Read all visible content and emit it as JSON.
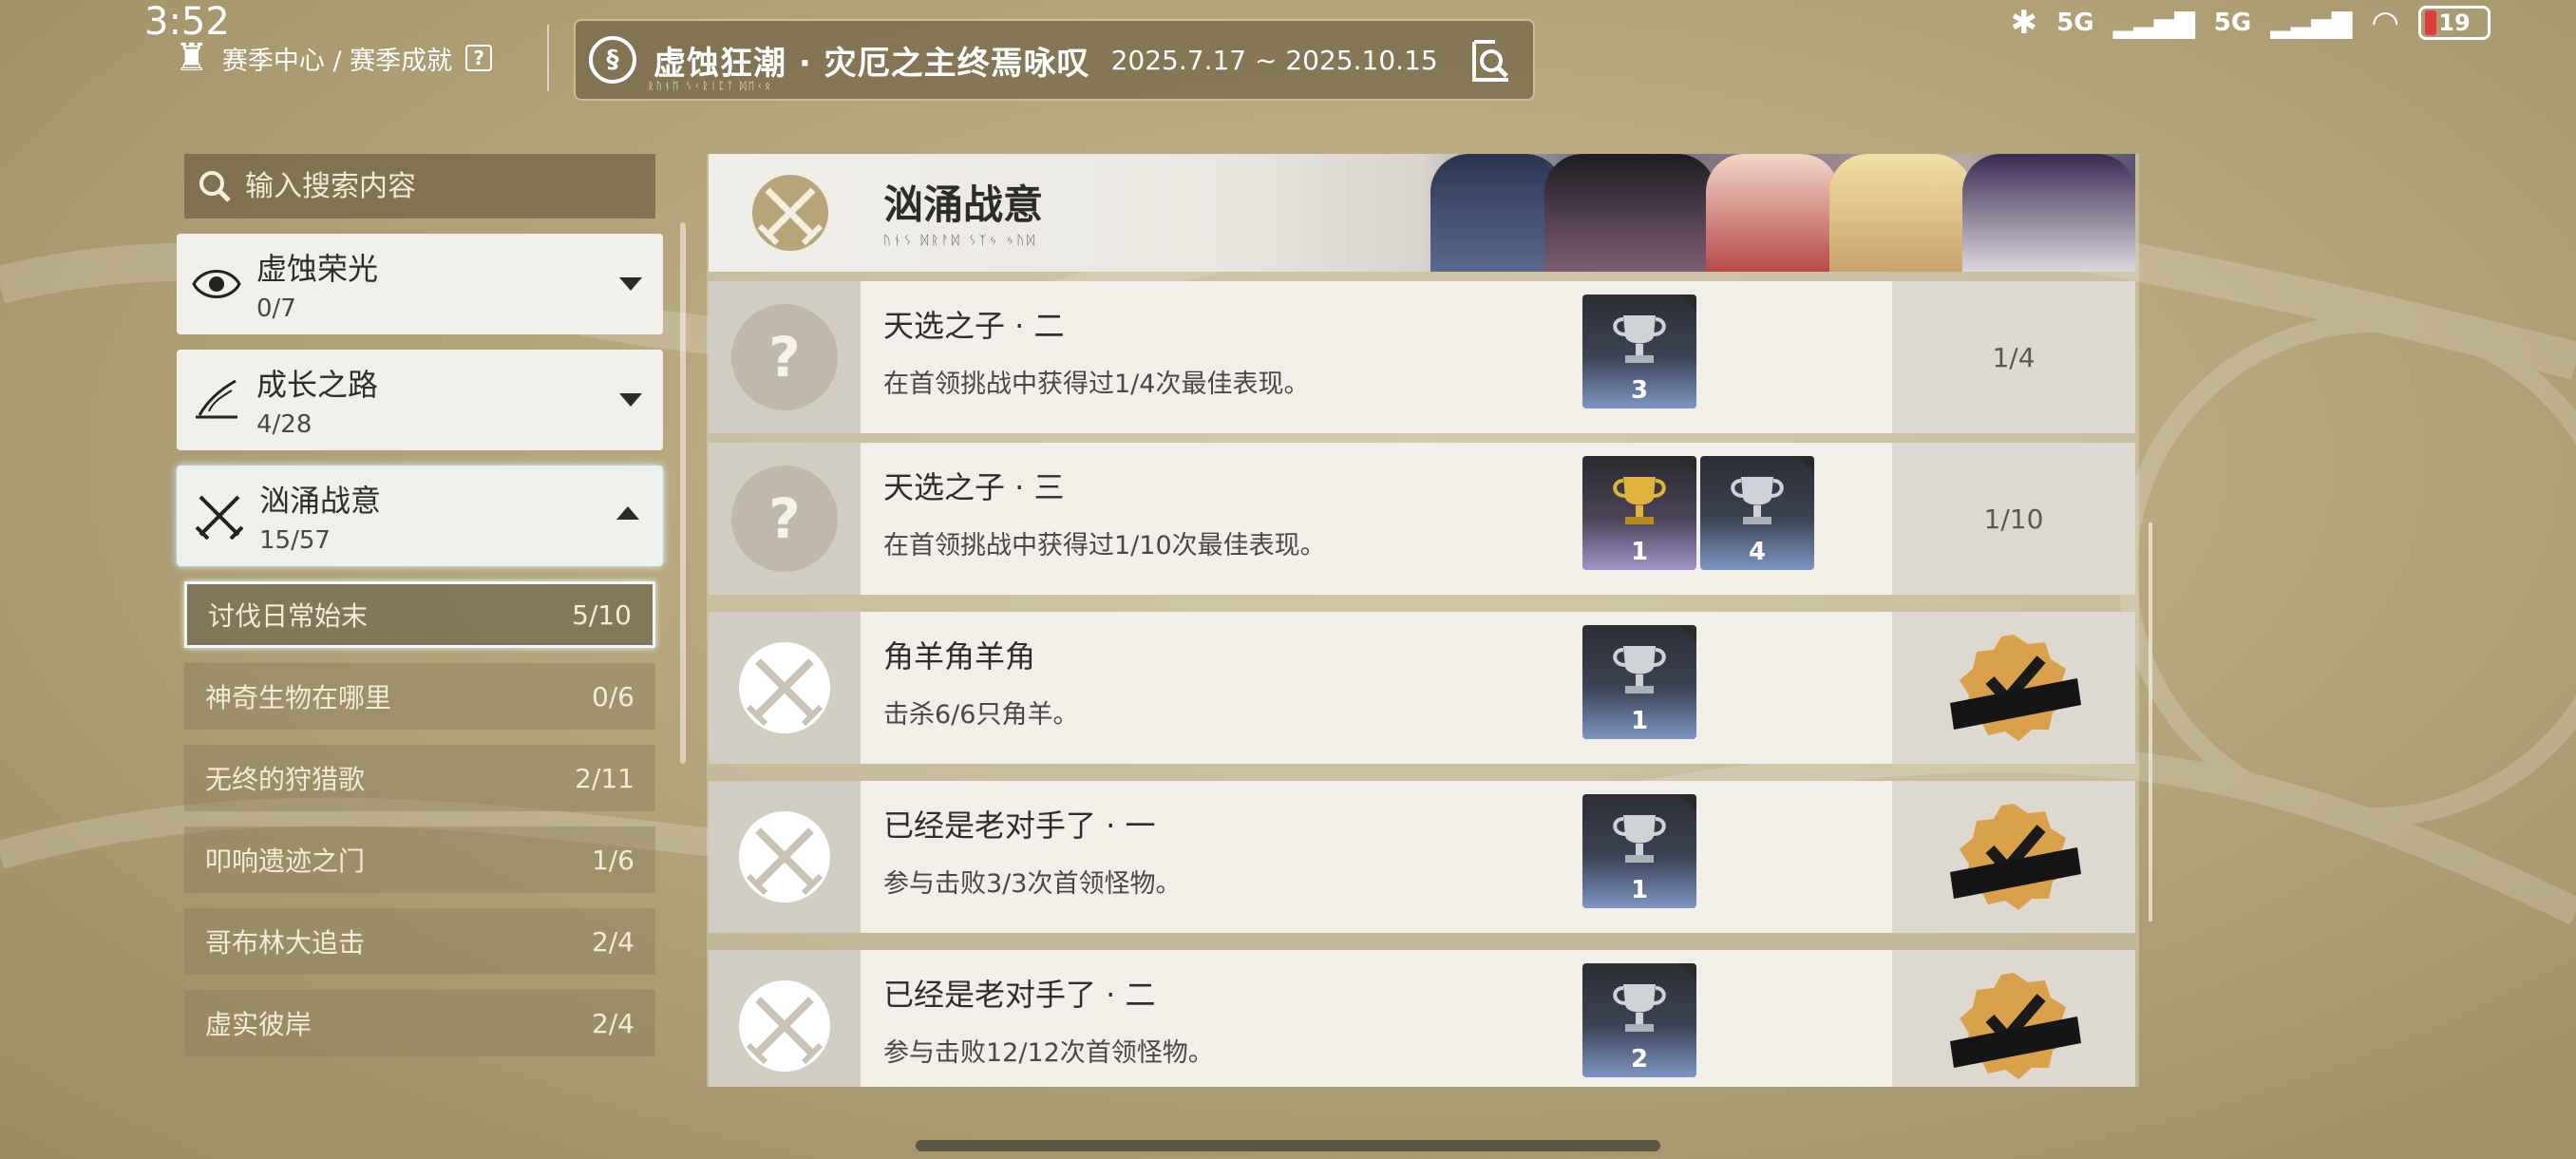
{
  "status": {
    "time": "3:52",
    "network1": "5G",
    "network2": "5G",
    "battery": "19"
  },
  "header": {
    "breadcrumb": "赛季中心 / 赛季成就",
    "help_label": "?",
    "season_title": "虚蚀狂潮 · 灾厄之主终焉咏叹",
    "season_dates": "2025.7.17 ~ 2025.10.15"
  },
  "search": {
    "placeholder": "输入搜索内容"
  },
  "categories": [
    {
      "name": "虚蚀荣光",
      "count": "0/7",
      "icon": "eye-emblem-icon"
    },
    {
      "name": "成长之路",
      "count": "4/28",
      "icon": "quill-book-icon"
    },
    {
      "name": "汹涌战意",
      "count": "15/57",
      "icon": "crossed-swords-icon"
    }
  ],
  "subcategories": [
    {
      "name": "讨伐日常始末",
      "count": "5/10"
    },
    {
      "name": "神奇生物在哪里",
      "count": "0/6"
    },
    {
      "name": "无终的狩猎歌",
      "count": "2/11"
    },
    {
      "name": "叩响遗迹之门",
      "count": "1/6"
    },
    {
      "name": "哥布林大追击",
      "count": "2/4"
    },
    {
      "name": "虚实彼岸",
      "count": "2/4"
    }
  ],
  "section": {
    "title": "汹涌战意"
  },
  "achievements": [
    {
      "title": "天选之子 · 二",
      "desc": "在首领挑战中获得过1/4次最佳表现。",
      "status": "locked",
      "progress": "1/4",
      "rewards": [
        {
          "tier": "silver",
          "qty": "3"
        }
      ]
    },
    {
      "title": "天选之子 · 三",
      "desc": "在首领挑战中获得过1/10次最佳表现。",
      "status": "locked",
      "progress": "1/10",
      "rewards": [
        {
          "tier": "gold",
          "qty": "1"
        },
        {
          "tier": "silver",
          "qty": "4"
        }
      ]
    },
    {
      "title": "角羊角羊角",
      "desc": "击杀6/6只角羊。",
      "status": "done",
      "progress": "",
      "rewards": [
        {
          "tier": "silver",
          "qty": "1"
        }
      ]
    },
    {
      "title": "已经是老对手了 · 一",
      "desc": "参与击败3/3次首领怪物。",
      "status": "done",
      "progress": "",
      "rewards": [
        {
          "tier": "silver",
          "qty": "1"
        }
      ]
    },
    {
      "title": "已经是老对手了 · 二",
      "desc": "参与击败12/12次首领怪物。",
      "status": "done",
      "progress": "",
      "rewards": [
        {
          "tier": "silver",
          "qty": "2"
        }
      ]
    }
  ],
  "colors": {
    "accent": "#e3f4f7",
    "badge_gold": "#d9a24a",
    "panel": "#f2efe8"
  }
}
